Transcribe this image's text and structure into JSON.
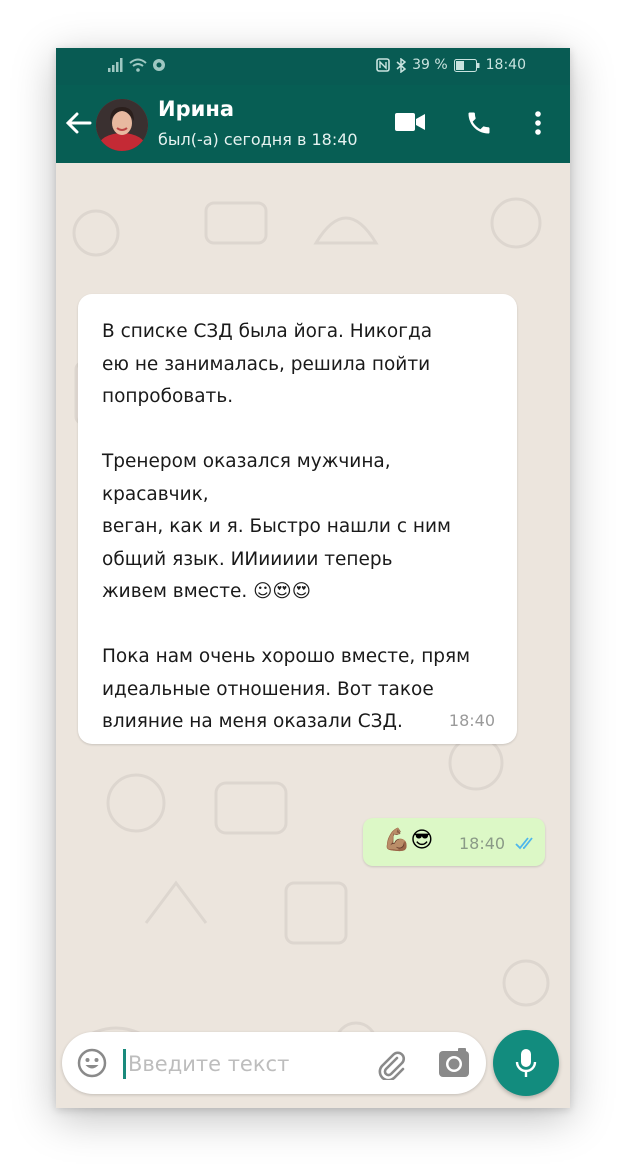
{
  "status_bar": {
    "battery_percent": "39 %",
    "time": "18:40"
  },
  "header": {
    "contact_name": "Ирина",
    "last_seen": "был(-а) сегодня в 18:40",
    "icons": [
      "back-arrow-icon",
      "video-call-icon",
      "phone-icon",
      "more-vert-icon"
    ]
  },
  "messages": [
    {
      "direction": "incoming",
      "text": "В списке СЗД была йога. Никогда\nею не занималась, решила пойти\nпопробовать.\n\nТренером оказался мужчина, красавчик,\nвеган, как и я. Быстро нашли с ним\nобщий язык. ИИиииии теперь\nживем вместе. ☺😍😍\n\nПока нам очень хорошо вместе, прям\nидеальные отношения. Вот такое\nвлияние на меня оказали СЗД.",
      "time": "18:40"
    },
    {
      "direction": "outgoing",
      "text": "💪🏽😎",
      "time": "18:40",
      "status": "read"
    }
  ],
  "composer": {
    "placeholder": "Введите текст",
    "value": "",
    "icons": [
      "emoji-icon",
      "attach-icon",
      "camera-icon",
      "mic-icon"
    ]
  },
  "colors": {
    "status_bar": "#085b53",
    "header": "#075e54",
    "chat_background": "#ece5dd",
    "outgoing_bubble": "#dcf8c6",
    "mic_button": "#128c7e",
    "read_ticks": "#4fb6ec"
  }
}
